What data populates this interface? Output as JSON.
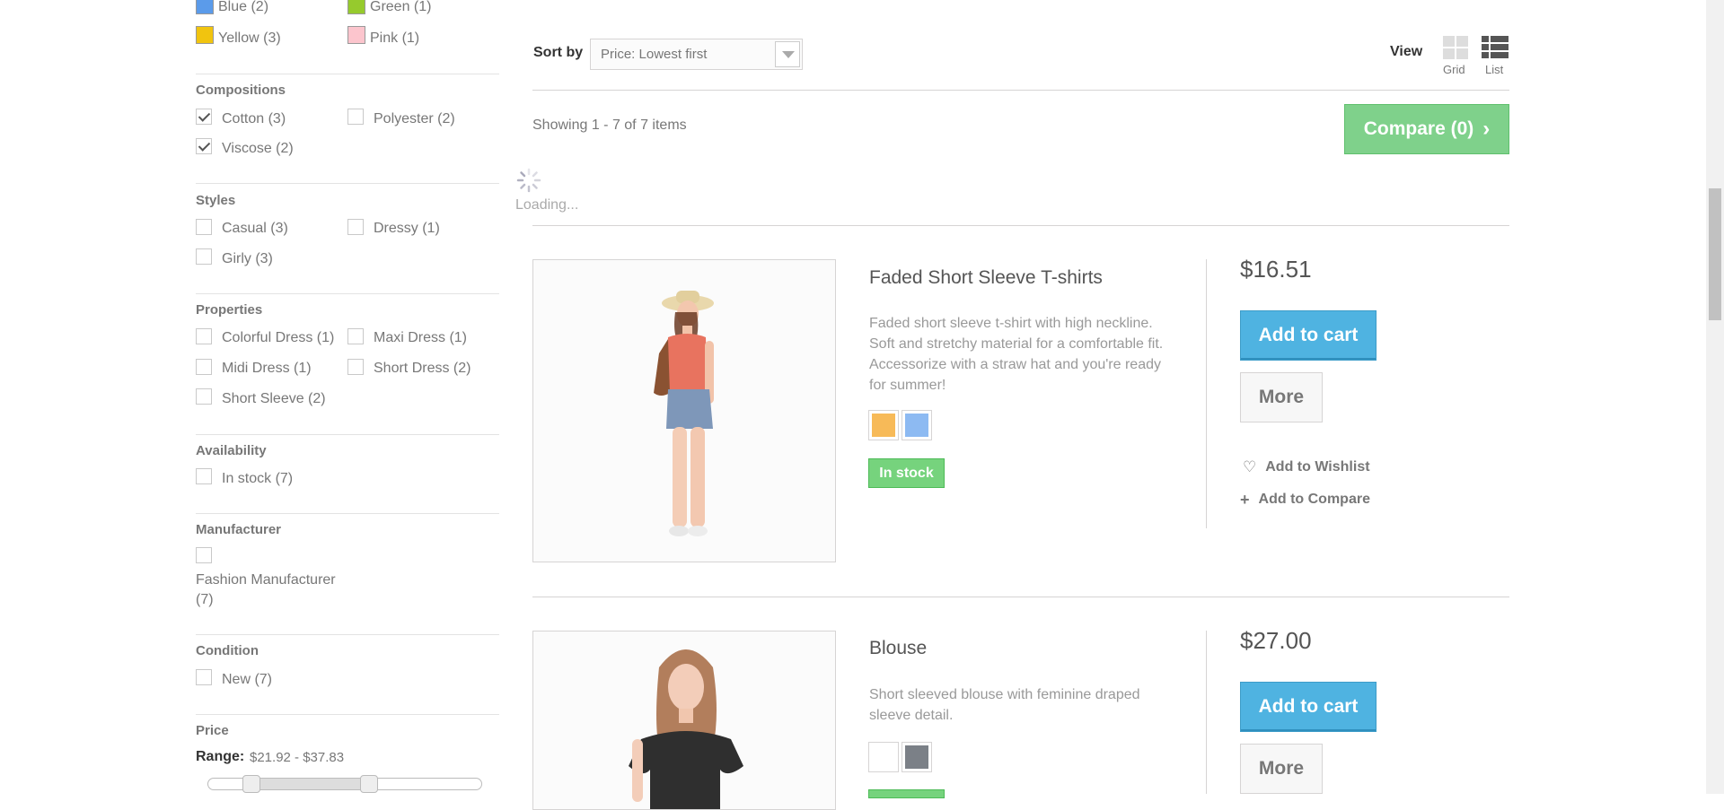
{
  "filters": {
    "colors": [
      {
        "label": "Blue (2)",
        "color": "#5b9bea"
      },
      {
        "label": "Green (1)",
        "color": "#96ca2d"
      },
      {
        "label": "Yellow (3)",
        "color": "#f1c40f"
      },
      {
        "label": "Pink (1)",
        "color": "#fcc5cd"
      }
    ],
    "compositions": {
      "title": "Compositions",
      "items": [
        {
          "label": "Cotton (3)",
          "checked": true
        },
        {
          "label": "Polyester (2)",
          "checked": false
        },
        {
          "label": "Viscose (2)",
          "checked": true
        }
      ]
    },
    "styles": {
      "title": "Styles",
      "items": [
        {
          "label": "Casual (3)"
        },
        {
          "label": "Dressy (1)"
        },
        {
          "label": "Girly (3)"
        }
      ]
    },
    "properties": {
      "title": "Properties",
      "items": [
        {
          "label": "Colorful Dress (1)"
        },
        {
          "label": "Maxi Dress (1)"
        },
        {
          "label": "Midi Dress (1)"
        },
        {
          "label": "Short Dress (2)"
        },
        {
          "label": "Short Sleeve (2)"
        }
      ]
    },
    "availability": {
      "title": "Availability",
      "items": [
        {
          "label": "In stock (7)"
        }
      ]
    },
    "manufacturer": {
      "title": "Manufacturer",
      "items": [
        {
          "label_line1": "Fashion Manufacturer",
          "label_line2": "(7)"
        }
      ]
    },
    "condition": {
      "title": "Condition",
      "items": [
        {
          "label": "New (7)"
        }
      ]
    },
    "price": {
      "title": "Price",
      "range_label": "Range:",
      "range_value": "$21.92 - $37.83"
    }
  },
  "toolbar": {
    "sort_label": "Sort by",
    "sort_value": "Price: Lowest first",
    "view_label": "View",
    "grid_label": "Grid",
    "list_label": "List",
    "showing": "Showing 1 - 7 of 7 items",
    "compare_label": "Compare (0)",
    "loading": "Loading..."
  },
  "products": [
    {
      "name": "Faded Short Sleeve T-shirts",
      "description": "Faded short sleeve t-shirt with high neckline. Soft and stretchy material for a comfortable fit. Accessorize with a straw hat and you're ready for summer!",
      "price": "$16.51",
      "colors": [
        "#f39c11",
        "#5d9cec"
      ],
      "stock": "In stock",
      "add_to_cart": "Add to cart",
      "more": "More",
      "wishlist": "Add to Wishlist",
      "compare": "Add to Compare"
    },
    {
      "name": "Blouse",
      "description": "Short sleeved blouse with feminine draped sleeve detail.",
      "price": "$27.00",
      "colors": [
        "#ffffff",
        "#434a54"
      ],
      "add_to_cart": "Add to cart",
      "more": "More"
    }
  ],
  "accent": {
    "cart_blue": "#4fb3e1",
    "compare_green": "#7fd18b",
    "stock_green": "#55c65e"
  }
}
